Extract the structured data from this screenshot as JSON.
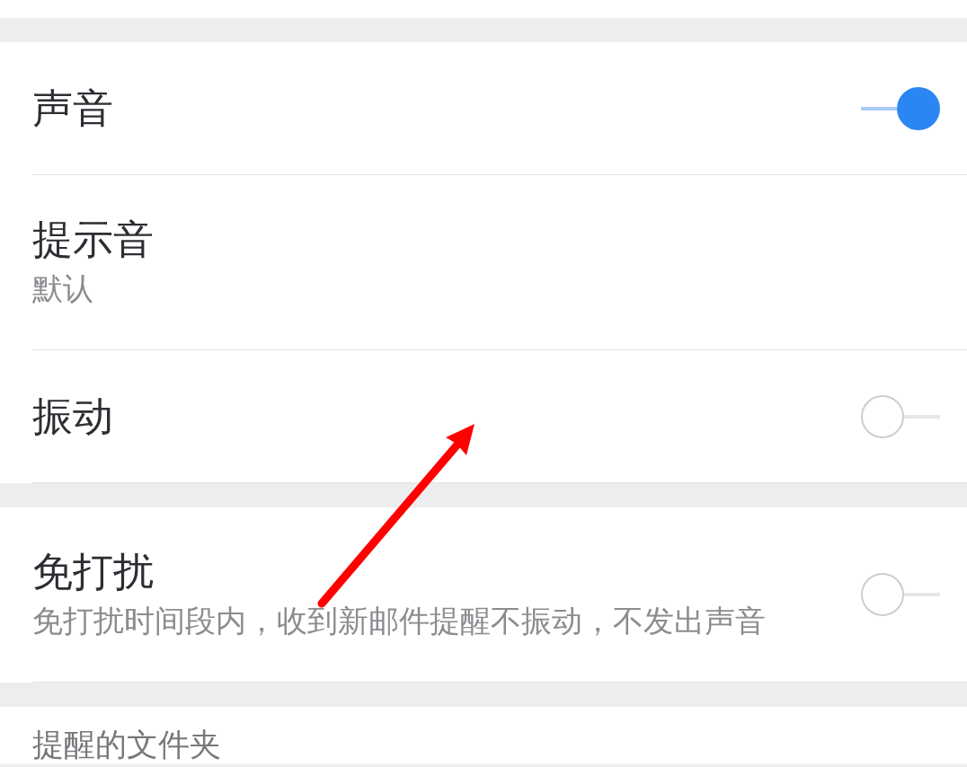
{
  "sections": [
    {
      "items": [
        {
          "kind": "switch",
          "title": "声音",
          "on": true
        },
        {
          "kind": "value",
          "title": "提示音",
          "subtitle": "默认"
        },
        {
          "kind": "switch",
          "title": "振动",
          "on": false
        }
      ]
    },
    {
      "items": [
        {
          "kind": "switch",
          "title": "免打扰",
          "subtitle": "免打扰时间段内，收到新邮件提醒不振动，不发出声音",
          "on": false
        }
      ]
    },
    {
      "header": "提醒的文件夹"
    }
  ]
}
